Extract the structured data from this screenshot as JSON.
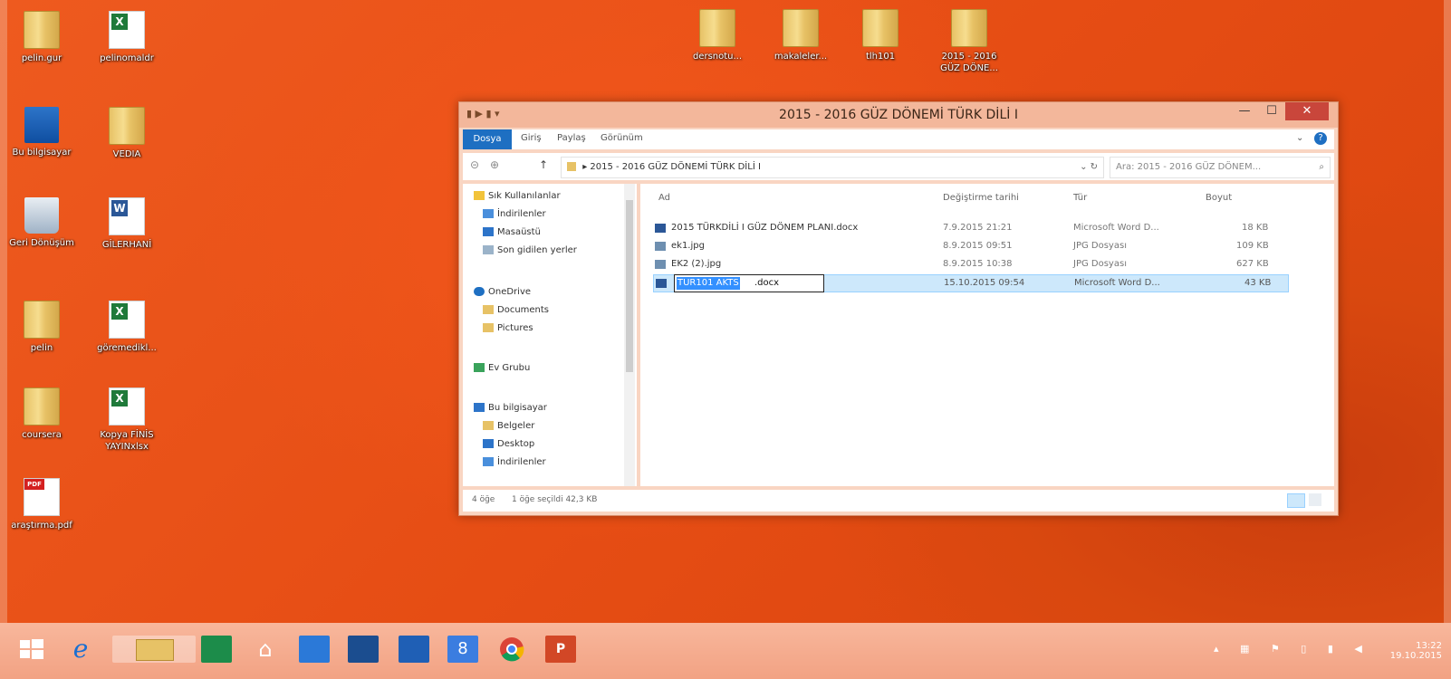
{
  "desktop": {
    "icons": [
      {
        "label": "pelin.gur",
        "type": "folder"
      },
      {
        "label": "pelinomaldr",
        "type": "xls"
      },
      {
        "label": "Bu bilgisayar",
        "type": "pc"
      },
      {
        "label": "VEDIA",
        "type": "folder"
      },
      {
        "label": "Geri Dönüşüm",
        "type": "bin"
      },
      {
        "label": "GİLERHANİ",
        "type": "word"
      },
      {
        "label": "pelin",
        "type": "folder"
      },
      {
        "label": "göremedikl...",
        "type": "xls"
      },
      {
        "label": "coursera",
        "type": "folder"
      },
      {
        "label": "Kopya FİNİS YAYINxlsx",
        "type": "xls"
      },
      {
        "label": "araştırma.pdf",
        "type": "pdf"
      },
      {
        "label": "dersnotu...",
        "type": "folder"
      },
      {
        "label": "makaleler...",
        "type": "folder"
      },
      {
        "label": "tlh101",
        "type": "folder"
      },
      {
        "label": "2015 - 2016 GÜZ DÖNE...",
        "type": "folder"
      }
    ]
  },
  "window": {
    "title": "2015 - 2016 GÜZ DÖNEMİ TÜRK DİLİ I",
    "buttons": {
      "minimize": "—",
      "maximize": "☐",
      "close": "✕"
    },
    "ribbon": {
      "file_tab": "Dosya",
      "tabs": [
        "Giriş",
        "Paylaş",
        "Görünüm"
      ]
    },
    "address": {
      "path": "2015 - 2016 GÜZ DÖNEMİ TÜRK DİLİ I",
      "search_placeholder": "Ara: 2015 - 2016 GÜZ DÖNEM..."
    },
    "nav": {
      "items": [
        {
          "label": "Sık Kullanılanlar",
          "icon": "star-icon"
        },
        {
          "label": "İndirilenler",
          "icon": "download-icon"
        },
        {
          "label": "Masaüstü",
          "icon": "desktop-icon"
        },
        {
          "label": "Son gidilen yerler",
          "icon": "recent-icon"
        },
        {
          "label": "OneDrive",
          "icon": "cloud-icon"
        },
        {
          "label": "Documents",
          "icon": "folder-icon"
        },
        {
          "label": "Pictures",
          "icon": "folder-icon"
        },
        {
          "label": "Ev Grubu",
          "icon": "homegroup-icon"
        },
        {
          "label": "Bu bilgisayar",
          "icon": "computer-icon"
        },
        {
          "label": "Belgeler",
          "icon": "documents-icon"
        },
        {
          "label": "Desktop",
          "icon": "desktop-icon"
        },
        {
          "label": "İndirilenler",
          "icon": "download-icon"
        }
      ]
    },
    "columns": {
      "name": "Ad",
      "date": "Değiştirme tarihi",
      "type": "Tür",
      "size": "Boyut"
    },
    "files": [
      {
        "name": "2015 TÜRKDİLİ I GÜZ DÖNEM PLANI.docx",
        "date": "7.9.2015 21:21",
        "type": "Microsoft Word D...",
        "size": "18 KB"
      },
      {
        "name": "ek1.jpg",
        "date": "8.9.2015 09:51",
        "type": "JPG Dosyası",
        "size": "109 KB"
      },
      {
        "name": "EK2 (2).jpg",
        "date": "8.9.2015 10:38",
        "type": "JPG Dosyası",
        "size": "627 KB"
      },
      {
        "name": "TUR101 AKTS.docx",
        "date": "15.10.2015 09:54",
        "type": "Microsoft Word D...",
        "size": "43 KB"
      }
    ],
    "rename": {
      "selected": "TUR101 AKTS",
      "ext": ".docx"
    },
    "status": {
      "count": "4 öğe",
      "selected": "1 öğe seçildi  42,3 KB"
    }
  },
  "taskbar": {
    "time": "13:22",
    "date": "19.10.2015"
  }
}
